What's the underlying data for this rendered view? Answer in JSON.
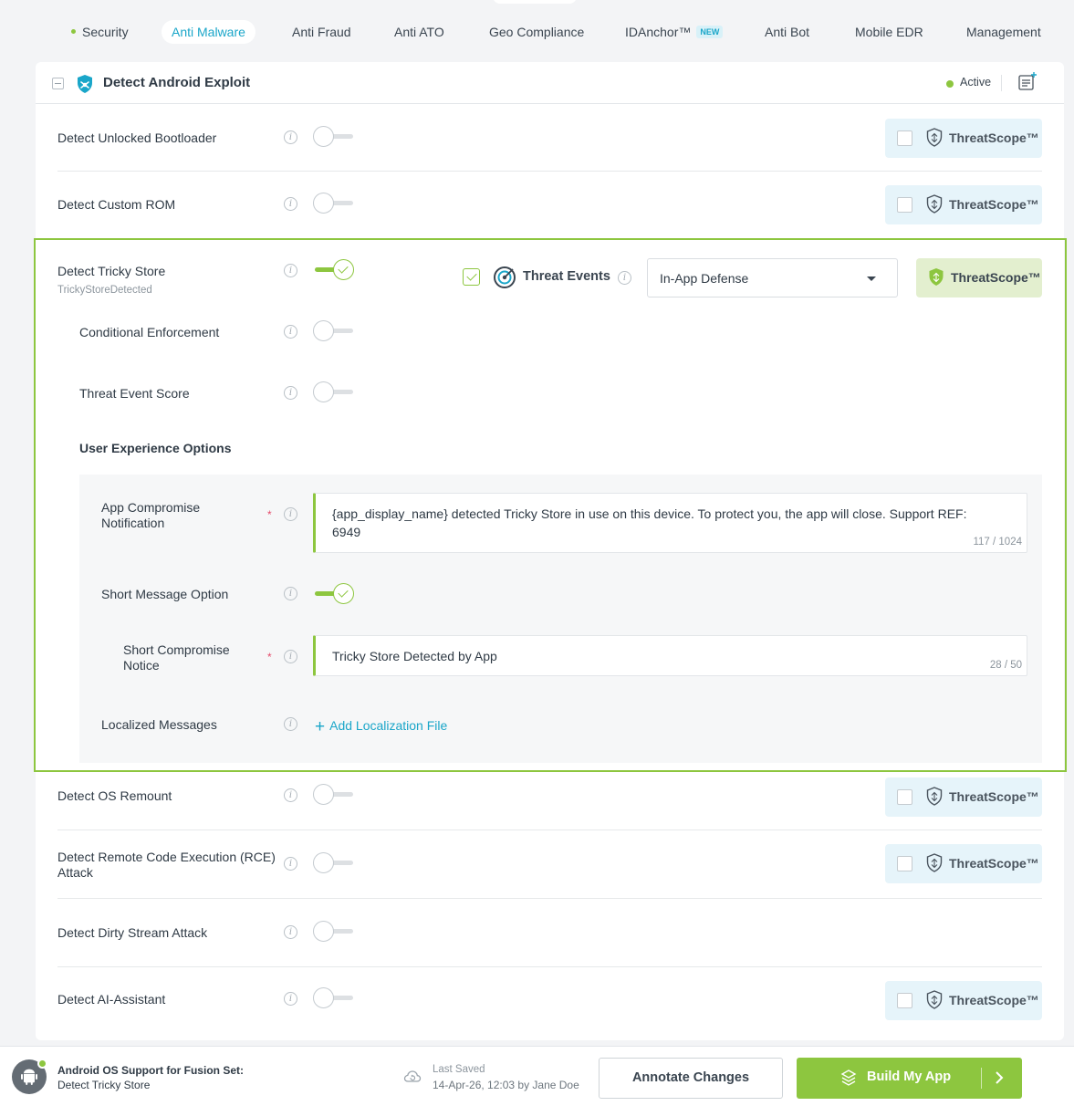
{
  "tabs": [
    {
      "label": "Security",
      "active": false,
      "dot": true
    },
    {
      "label": "Anti Malware",
      "active": true
    },
    {
      "label": "Anti Fraud"
    },
    {
      "label": "Anti ATO"
    },
    {
      "label": "Geo Compliance"
    },
    {
      "label": "IDAnchor™",
      "badge": "NEW"
    },
    {
      "label": "Anti Bot"
    },
    {
      "label": "Mobile EDR"
    },
    {
      "label": "Management"
    }
  ],
  "card": {
    "title": "Detect Android Exploit",
    "status": "Active",
    "status_color": "#8dc63f"
  },
  "threatscope_label": "ThreatScope™",
  "rows": [
    {
      "label": "Detect Unlocked Bootloader",
      "enabled": false
    },
    {
      "label": "Detect Custom ROM",
      "enabled": false
    },
    {
      "label": "Detect Tricky Store",
      "sub": "TrickyStoreDetected",
      "enabled": true
    },
    {
      "label": "Detect OS Remount",
      "enabled": false
    },
    {
      "label": "Detect Remote Code Execution (RCE) Attack",
      "enabled": false
    },
    {
      "label": "Detect Dirty Stream Attack",
      "enabled": false
    },
    {
      "label": "Detect AI-Assistant",
      "enabled": false
    }
  ],
  "expanded": {
    "threat_events_label": "Threat Events",
    "threat_events_checked": true,
    "response_select": "In-App Defense",
    "conditional_enforcement": {
      "label": "Conditional Enforcement",
      "enabled": false
    },
    "threat_event_score": {
      "label": "Threat Event Score",
      "enabled": false
    },
    "ux_heading": "User Experience Options",
    "app_notification": {
      "label_line1": "App Compromise",
      "label_line2": "Notification",
      "text_line1": "{app_display_name} detected Tricky Store in use on this device. To protect you, the app will close. Support REF:",
      "text_line2": "6949",
      "count": "117 / 1024"
    },
    "short_message_option": {
      "label": "Short Message Option",
      "enabled": true
    },
    "short_notice": {
      "label_line1": "Short Compromise",
      "label_line2": "Notice",
      "text": "Tricky Store Detected by App",
      "count": "28 / 50"
    },
    "localized": {
      "label": "Localized Messages",
      "action": "Add Localization File"
    }
  },
  "footer": {
    "title": "Android OS Support for Fusion Set:",
    "subtitle": "Detect Tricky Store",
    "last_saved_label": "Last Saved",
    "last_saved_value": "14-Apr-26, 12:03 by Jane Doe",
    "annotate": "Annotate Changes",
    "build": "Build My App"
  },
  "colors": {
    "accent": "#8dc63f",
    "link": "#1aa6c9",
    "threatscope_bg": "#e6f4fa"
  }
}
